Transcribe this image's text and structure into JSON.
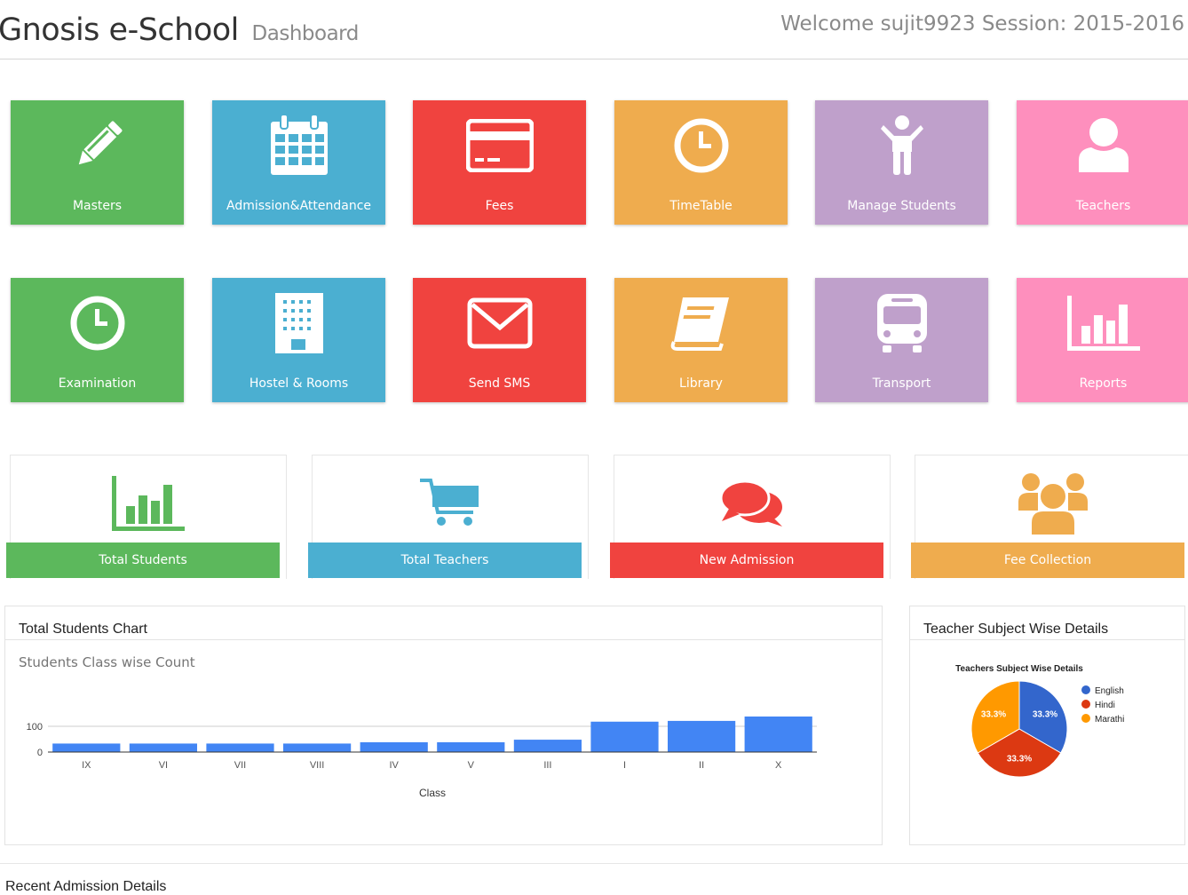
{
  "header": {
    "app_title": "Gnosis e-School",
    "page_subtitle": "Dashboard",
    "welcome_text": "Welcome sujit9923 Session: 2015-2016"
  },
  "tiles": [
    {
      "label": "Masters",
      "icon": "pencil-icon",
      "color": "#5cb85c"
    },
    {
      "label": "Admission&Attendance",
      "icon": "calendar-icon",
      "color": "#4bafd1"
    },
    {
      "label": "Fees",
      "icon": "credit-card-icon",
      "color": "#f0433f"
    },
    {
      "label": "TimeTable",
      "icon": "clock-icon",
      "color": "#efac4e"
    },
    {
      "label": "Manage Students",
      "icon": "child-icon",
      "color": "#bfa0cb"
    },
    {
      "label": "Teachers",
      "icon": "user-icon",
      "color": "#fe8fbd"
    },
    {
      "label": "Examination",
      "icon": "clock-icon",
      "color": "#5cb85c"
    },
    {
      "label": "Hostel & Rooms",
      "icon": "building-icon",
      "color": "#4bafd1"
    },
    {
      "label": "Send SMS",
      "icon": "envelope-icon",
      "color": "#f0433f"
    },
    {
      "label": "Library",
      "icon": "book-icon",
      "color": "#efac4e"
    },
    {
      "label": "Transport",
      "icon": "bus-icon",
      "color": "#bfa0cb"
    },
    {
      "label": "Reports",
      "icon": "bar-chart-icon",
      "color": "#fe8fbd"
    }
  ],
  "stats": [
    {
      "label": "Total Students",
      "icon": "bar-chart-icon",
      "color": "#5cb85c"
    },
    {
      "label": "Total Teachers",
      "icon": "shopping-cart-icon",
      "color": "#4bafd1"
    },
    {
      "label": "New Admission",
      "icon": "comments-icon",
      "color": "#f0433f"
    },
    {
      "label": "Fee Collection",
      "icon": "users-icon",
      "color": "#efac4e"
    }
  ],
  "students_panel": {
    "heading": "Total Students Chart"
  },
  "teachers_panel": {
    "heading": "Teacher Subject Wise Details"
  },
  "recent_admission": {
    "heading": "Recent Admission Details"
  },
  "chart_data": [
    {
      "type": "bar",
      "title": "Students Class wise Count",
      "xlabel": "Class",
      "ylabel": "",
      "categories": [
        "IX",
        "VI",
        "VII",
        "VIII",
        "IV",
        "V",
        "III",
        "I",
        "II",
        "X"
      ],
      "values": [
        33,
        33,
        33,
        33,
        38,
        38,
        48,
        118,
        121,
        138
      ],
      "y_ticks": [
        0,
        100
      ],
      "ylim": [
        0,
        150
      ],
      "color": "#4285f4",
      "grid": true
    },
    {
      "type": "pie",
      "title": "Teachers Subject Wise Details",
      "slices": [
        {
          "label": "English",
          "value": 33.3,
          "display": "33.3%",
          "color": "#3366cc"
        },
        {
          "label": "Hindi",
          "value": 33.3,
          "display": "33.3%",
          "color": "#dc3912"
        },
        {
          "label": "Marathi",
          "value": 33.3,
          "display": "33.3%",
          "color": "#ff9900"
        }
      ],
      "legend": "right"
    }
  ]
}
